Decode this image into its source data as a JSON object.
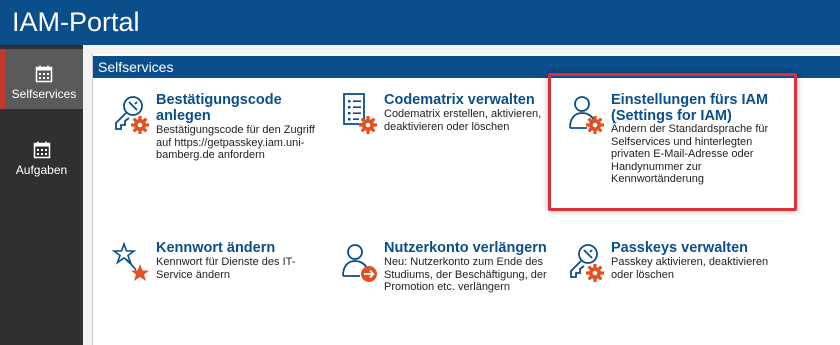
{
  "app": {
    "title": "IAM-Portal"
  },
  "sidebar": {
    "items": [
      {
        "label": "Selfservices",
        "icon": "calendar-icon",
        "active": true
      },
      {
        "label": "Aufgaben",
        "icon": "calendar-icon",
        "active": false
      }
    ]
  },
  "panel": {
    "title": "Selfservices"
  },
  "cards": [
    {
      "title": "Bestätigungscode anlegen",
      "description": "Bestätigungscode für den Zugriff auf https://getpasskey.iam.uni-bamberg.de anfordern",
      "icon": "key-gear-icon"
    },
    {
      "title": "Codematrix verwalten",
      "description": "Codematrix erstellen, aktivieren, deaktivieren oder löschen",
      "icon": "list-gear-icon"
    },
    {
      "title": "Einstellungen fürs IAM (Settings for IAM)",
      "description": "Ändern der Standardsprache für Selfservices und hinterlegten privaten E-Mail-Adresse oder Handynummer zur Kennwortänderung",
      "icon": "user-gear-icon"
    },
    {
      "title": "Kennwort ändern",
      "description": "Kennwort für Dienste des IT-Service ändern",
      "icon": "star-icon"
    },
    {
      "title": "Nutzerkonto verlängern",
      "description": "Neu: Nutzerkonto zum Ende des Studiums, der Beschäftigung, der Promotion etc. verlängern",
      "icon": "user-arrow-icon"
    },
    {
      "title": "Passkeys verwalten",
      "description": "Passkey aktivieren, deaktivieren oder löschen",
      "icon": "key-gear-icon"
    }
  ],
  "colors": {
    "brand_blue": "#0b4e8c",
    "accent_orange": "#e2511f",
    "highlight_red": "#d9303a",
    "sidebar_dark": "#303030"
  }
}
